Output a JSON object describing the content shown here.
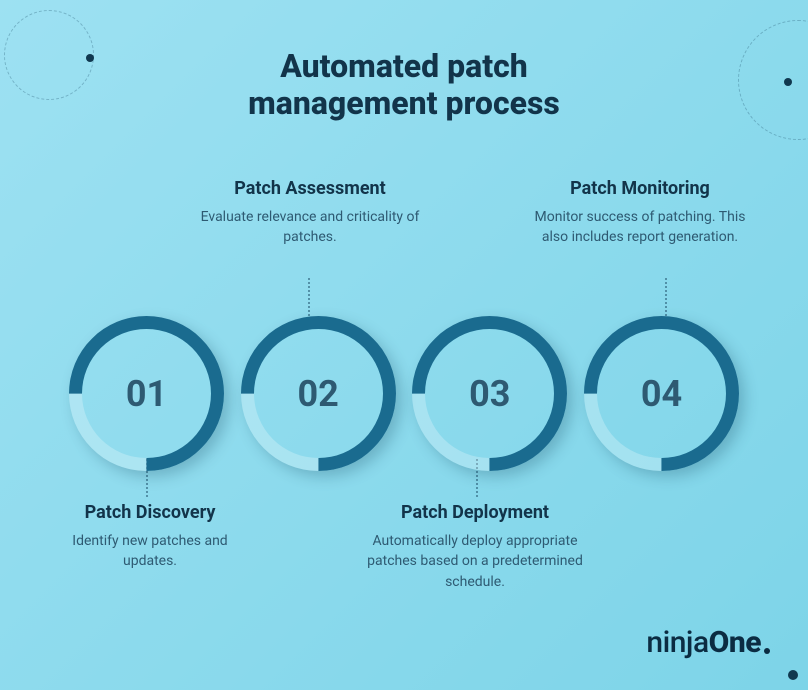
{
  "title_line1": "Automated patch",
  "title_line2": "management process",
  "steps": [
    {
      "num": "01",
      "title": "Patch Discovery",
      "desc": "Identify new patches and updates."
    },
    {
      "num": "02",
      "title": "Patch Assessment",
      "desc": "Evaluate relevance and criticality of patches."
    },
    {
      "num": "03",
      "title": "Patch Deployment",
      "desc": "Automatically deploy appropriate patches based on a predetermined schedule."
    },
    {
      "num": "04",
      "title": "Patch Monitoring",
      "desc": "Monitor success of patching. This also includes report generation."
    }
  ],
  "logo": {
    "part1": "ninja",
    "part2": "One"
  },
  "colors": {
    "bg_start": "#9DE1F2",
    "bg_end": "#7DD4E8",
    "ring": "#1a6b8f",
    "text": "#12344a"
  }
}
